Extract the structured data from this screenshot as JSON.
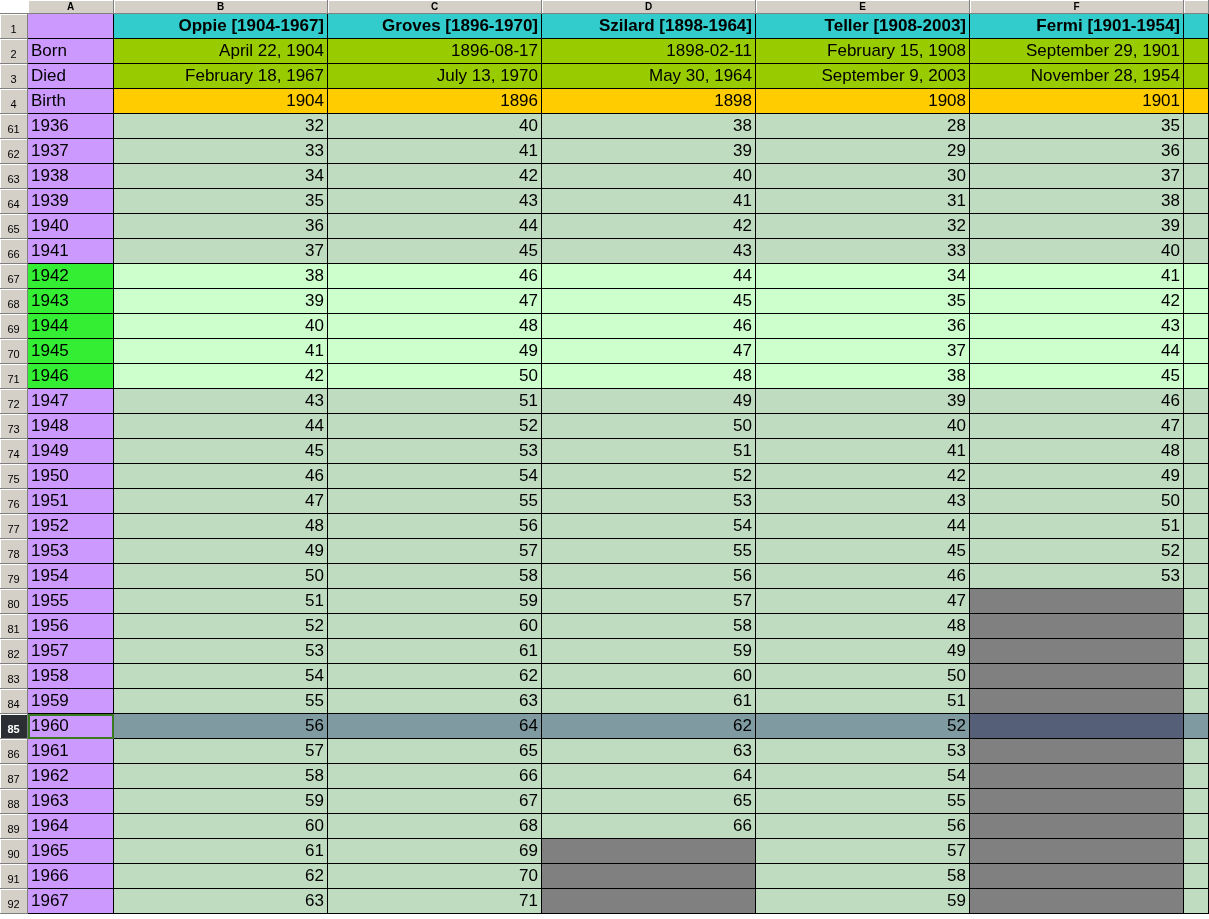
{
  "column_headers": [
    "A",
    "B",
    "C",
    "D",
    "E",
    "F"
  ],
  "info_rows": [
    {
      "number": "1",
      "kind": "names",
      "cells": [
        "Oppie [1904-1967]",
        "Groves [1896-1970]",
        "Szilard [1898-1964]",
        "Teller [1908-2003]",
        "Fermi [1901-1954]"
      ]
    },
    {
      "number": "2",
      "kind": "dates",
      "label": "Born",
      "cells": [
        "April 22, 1904",
        "1896-08-17",
        "1898-02-11",
        "February 15, 1908",
        "September 29, 1901"
      ]
    },
    {
      "number": "3",
      "kind": "dates",
      "label": "Died",
      "cells": [
        "February 18, 1967",
        "July 13, 1970",
        "May 30, 1964",
        "September 9, 2003",
        "November 28, 1954"
      ]
    },
    {
      "number": "4",
      "kind": "birth",
      "label": "Birth",
      "cells": [
        "1904",
        "1896",
        "1898",
        "1908",
        "1901"
      ]
    }
  ],
  "rows": [
    {
      "number": "61",
      "label": "1936",
      "highlighted": false,
      "selected": false,
      "cells": [
        "32",
        "40",
        "38",
        "28",
        "35"
      ]
    },
    {
      "number": "62",
      "label": "1937",
      "highlighted": false,
      "selected": false,
      "cells": [
        "33",
        "41",
        "39",
        "29",
        "36"
      ]
    },
    {
      "number": "63",
      "label": "1938",
      "highlighted": false,
      "selected": false,
      "cells": [
        "34",
        "42",
        "40",
        "30",
        "37"
      ]
    },
    {
      "number": "64",
      "label": "1939",
      "highlighted": false,
      "selected": false,
      "cells": [
        "35",
        "43",
        "41",
        "31",
        "38"
      ]
    },
    {
      "number": "65",
      "label": "1940",
      "highlighted": false,
      "selected": false,
      "cells": [
        "36",
        "44",
        "42",
        "32",
        "39"
      ]
    },
    {
      "number": "66",
      "label": "1941",
      "highlighted": false,
      "selected": false,
      "cells": [
        "37",
        "45",
        "43",
        "33",
        "40"
      ]
    },
    {
      "number": "67",
      "label": "1942",
      "highlighted": true,
      "selected": false,
      "cells": [
        "38",
        "46",
        "44",
        "34",
        "41"
      ]
    },
    {
      "number": "68",
      "label": "1943",
      "highlighted": true,
      "selected": false,
      "cells": [
        "39",
        "47",
        "45",
        "35",
        "42"
      ]
    },
    {
      "number": "69",
      "label": "1944",
      "highlighted": true,
      "selected": false,
      "cells": [
        "40",
        "48",
        "46",
        "36",
        "43"
      ]
    },
    {
      "number": "70",
      "label": "1945",
      "highlighted": true,
      "selected": false,
      "cells": [
        "41",
        "49",
        "47",
        "37",
        "44"
      ]
    },
    {
      "number": "71",
      "label": "1946",
      "highlighted": true,
      "selected": false,
      "cells": [
        "42",
        "50",
        "48",
        "38",
        "45"
      ]
    },
    {
      "number": "72",
      "label": "1947",
      "highlighted": false,
      "selected": false,
      "cells": [
        "43",
        "51",
        "49",
        "39",
        "46"
      ]
    },
    {
      "number": "73",
      "label": "1948",
      "highlighted": false,
      "selected": false,
      "cells": [
        "44",
        "52",
        "50",
        "40",
        "47"
      ]
    },
    {
      "number": "74",
      "label": "1949",
      "highlighted": false,
      "selected": false,
      "cells": [
        "45",
        "53",
        "51",
        "41",
        "48"
      ]
    },
    {
      "number": "75",
      "label": "1950",
      "highlighted": false,
      "selected": false,
      "cells": [
        "46",
        "54",
        "52",
        "42",
        "49"
      ]
    },
    {
      "number": "76",
      "label": "1951",
      "highlighted": false,
      "selected": false,
      "cells": [
        "47",
        "55",
        "53",
        "43",
        "50"
      ]
    },
    {
      "number": "77",
      "label": "1952",
      "highlighted": false,
      "selected": false,
      "cells": [
        "48",
        "56",
        "54",
        "44",
        "51"
      ]
    },
    {
      "number": "78",
      "label": "1953",
      "highlighted": false,
      "selected": false,
      "cells": [
        "49",
        "57",
        "55",
        "45",
        "52"
      ]
    },
    {
      "number": "79",
      "label": "1954",
      "highlighted": false,
      "selected": false,
      "cells": [
        "50",
        "58",
        "56",
        "46",
        "53"
      ]
    },
    {
      "number": "80",
      "label": "1955",
      "highlighted": false,
      "selected": false,
      "cells": [
        "51",
        "59",
        "57",
        "47",
        null
      ]
    },
    {
      "number": "81",
      "label": "1956",
      "highlighted": false,
      "selected": false,
      "cells": [
        "52",
        "60",
        "58",
        "48",
        null
      ]
    },
    {
      "number": "82",
      "label": "1957",
      "highlighted": false,
      "selected": false,
      "cells": [
        "53",
        "61",
        "59",
        "49",
        null
      ]
    },
    {
      "number": "83",
      "label": "1958",
      "highlighted": false,
      "selected": false,
      "cells": [
        "54",
        "62",
        "60",
        "50",
        null
      ]
    },
    {
      "number": "84",
      "label": "1959",
      "highlighted": false,
      "selected": false,
      "cells": [
        "55",
        "63",
        "61",
        "51",
        null
      ]
    },
    {
      "number": "85",
      "label": "1960",
      "highlighted": false,
      "selected": true,
      "cells": [
        "56",
        "64",
        "62",
        "52",
        null
      ]
    },
    {
      "number": "86",
      "label": "1961",
      "highlighted": false,
      "selected": false,
      "cells": [
        "57",
        "65",
        "63",
        "53",
        null
      ]
    },
    {
      "number": "87",
      "label": "1962",
      "highlighted": false,
      "selected": false,
      "cells": [
        "58",
        "66",
        "64",
        "54",
        null
      ]
    },
    {
      "number": "88",
      "label": "1963",
      "highlighted": false,
      "selected": false,
      "cells": [
        "59",
        "67",
        "65",
        "55",
        null
      ]
    },
    {
      "number": "89",
      "label": "1964",
      "highlighted": false,
      "selected": false,
      "cells": [
        "60",
        "68",
        "66",
        "56",
        null
      ]
    },
    {
      "number": "90",
      "label": "1965",
      "highlighted": false,
      "selected": false,
      "cells": [
        "61",
        "69",
        null,
        "57",
        null
      ]
    },
    {
      "number": "91",
      "label": "1966",
      "highlighted": false,
      "selected": false,
      "cells": [
        "62",
        "70",
        null,
        "58",
        null
      ]
    },
    {
      "number": "92",
      "label": "1967",
      "highlighted": false,
      "selected": false,
      "cells": [
        "63",
        "71",
        null,
        "59",
        null
      ]
    }
  ]
}
